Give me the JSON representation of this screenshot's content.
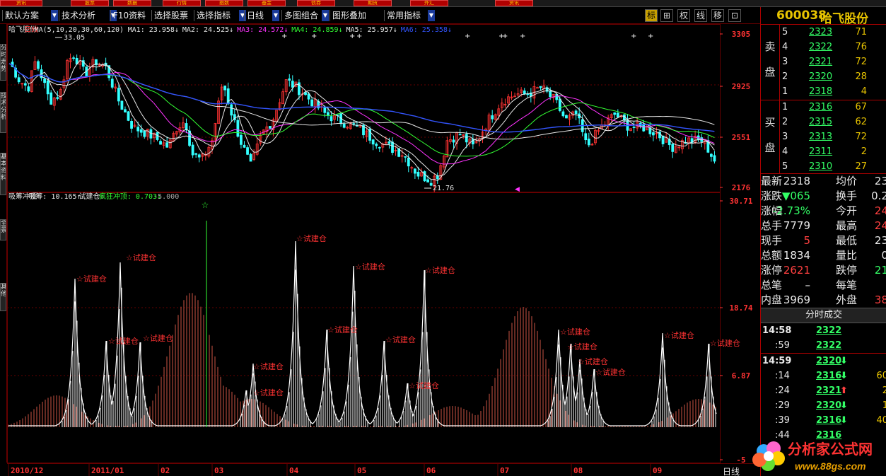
{
  "top_buttons": [
    "资讯",
    "股票",
    "数据",
    "行情",
    "指数",
    "基金",
    "债券",
    "期货",
    "外汇",
    "资讯"
  ],
  "toolbar": {
    "items": [
      {
        "label": "默认方案",
        "dropdown": true
      },
      {
        "label": "技术分析",
        "dropdown": true
      },
      {
        "label": "F10资料",
        "dropdown": false
      },
      {
        "label": "选择股票",
        "dropdown": false
      },
      {
        "label": "选择指标",
        "dropdown": true
      },
      {
        "label": "日线",
        "dropdown": true
      },
      {
        "label": "多图组合",
        "dropdown": true
      },
      {
        "label": "图形叠加",
        "dropdown": false
      },
      {
        "label": "常用指标",
        "dropdown": true
      }
    ],
    "right_buttons": [
      "标",
      "⊞",
      "权",
      "线",
      "移",
      "⊡"
    ]
  },
  "left_tabs": [
    "分时走势",
    "技术分析",
    "基本资料",
    "全景",
    "其他"
  ],
  "main_chart": {
    "stock_name": "哈飞股份",
    "period": "日线",
    "ma_params": "MA(5,10,20,30,60,120)",
    "ma_values": [
      {
        "label": "MA1: 23.958↓",
        "color": "#e8e8e8"
      },
      {
        "label": "MA2: 24.525↓",
        "color": "#e8e8e8"
      },
      {
        "label": "MA3: 24.572↓",
        "color": "#ff33ff"
      },
      {
        "label": "MA4: 24.859↓",
        "color": "#33ff33"
      },
      {
        "label": "MA5: 25.957↓",
        "color": "#e8e8e8"
      },
      {
        "label": "MA6: 25.358↓",
        "color": "#3355ff"
      }
    ],
    "high_label": "33.05",
    "low_label": "21.76",
    "y_labels": [
      "3305",
      "2925",
      "2551",
      "2176"
    ]
  },
  "sub_chart": {
    "title": "吸筹冲顶",
    "items": [
      {
        "label": "吸筹: 10.165↑",
        "color": "#e8e8e8"
      },
      {
        "label": "试建仓:",
        "color": "#e8e8e8"
      },
      {
        "label": "疯狂冲顶: 0.703↓",
        "color": "#33ff33"
      },
      {
        "label": "-5.000",
        "color": "#aaaaaa"
      }
    ],
    "signal_label": "☆试建仓",
    "y_labels": [
      "30.71",
      "18.74",
      "6.87",
      "-5"
    ]
  },
  "x_axis": [
    "2010/12",
    "2011/01",
    "02",
    "03",
    "04",
    "05",
    "06",
    "07",
    "08",
    "09"
  ],
  "x_period": "日线",
  "right_panel": {
    "code": "600038",
    "name": "哈飞股份",
    "sell_side": "卖盘",
    "buy_side": "买盘",
    "sell": [
      {
        "n": "5",
        "price": "2323",
        "vol": "71"
      },
      {
        "n": "4",
        "price": "2322",
        "vol": "76"
      },
      {
        "n": "3",
        "price": "2321",
        "vol": "72"
      },
      {
        "n": "2",
        "price": "2320",
        "vol": "28"
      },
      {
        "n": "1",
        "price": "2318",
        "vol": "4"
      }
    ],
    "buy": [
      {
        "n": "1",
        "price": "2316",
        "vol": "67"
      },
      {
        "n": "2",
        "price": "2315",
        "vol": "62"
      },
      {
        "n": "3",
        "price": "2313",
        "vol": "72"
      },
      {
        "n": "4",
        "price": "2311",
        "vol": "2"
      },
      {
        "n": "5",
        "price": "2310",
        "vol": "27"
      }
    ],
    "quotes": [
      {
        "l1": "最新",
        "v1": "2318",
        "c1": "wht",
        "l2": "均价",
        "v2": "23",
        "c2": "wht"
      },
      {
        "l1": "涨跌",
        "v1": "▼065",
        "c1": "grn",
        "l2": "换手",
        "v2": "0.2",
        "c2": "wht"
      },
      {
        "l1": "涨幅",
        "v1": "-2.73%",
        "c1": "grn",
        "l2": "今开",
        "v2": "24",
        "c2": "red"
      },
      {
        "l1": "总手",
        "v1": "7779",
        "c1": "wht",
        "l2": "最高",
        "v2": "24",
        "c2": "red"
      },
      {
        "l1": "现手",
        "v1": "5",
        "c1": "red",
        "l2": "最低",
        "v2": "23",
        "c2": "wht"
      },
      {
        "l1": "总额",
        "v1": "1834",
        "c1": "wht",
        "l2": "量比",
        "v2": "0",
        "c2": "wht"
      },
      {
        "l1": "涨停",
        "v1": "2621",
        "c1": "red",
        "l2": "跌停",
        "v2": "21",
        "c2": "grn"
      },
      {
        "l1": "总笔",
        "v1": "–",
        "c1": "wht",
        "l2": "每笔",
        "v2": "",
        "c2": "wht"
      },
      {
        "l1": "内盘",
        "v1": "3969",
        "c1": "wht",
        "l2": "外盘",
        "v2": "38",
        "c2": "red"
      }
    ],
    "ticks_title": "分时成交",
    "ticks": [
      {
        "time": "14:58",
        "price": "2322",
        "arrow": "",
        "c": "wht",
        "vol": ""
      },
      {
        "time": ":59",
        "price": "2322",
        "arrow": "",
        "c": "wht",
        "vol": ""
      },
      {
        "time": "14:59",
        "price": "2320",
        "arrow": "⬇",
        "c": "grn",
        "vol": ""
      },
      {
        "time": ":14",
        "price": "2316",
        "arrow": "⬇",
        "c": "grn",
        "vol": "60"
      },
      {
        "time": ":24",
        "price": "2321",
        "arrow": "⬆",
        "c": "red",
        "vol": "2"
      },
      {
        "time": ":29",
        "price": "2320",
        "arrow": "⬇",
        "c": "grn",
        "vol": "1"
      },
      {
        "time": ":39",
        "price": "2316",
        "arrow": "⬇",
        "c": "grn",
        "vol": "40"
      },
      {
        "time": ":44",
        "price": "2316",
        "arrow": "",
        "c": "wht",
        "vol": ""
      }
    ]
  },
  "logo": {
    "text": "分析家公式网",
    "url": "www.88gs.com"
  },
  "colors": {
    "bg": "#000000",
    "grid": "#660000",
    "up": "#ff3333",
    "down": "#33ffff",
    "ma3": "#ff33ff",
    "ma4": "#33ff33",
    "ma6": "#3355ff",
    "axis_text": "#ff3333"
  }
}
